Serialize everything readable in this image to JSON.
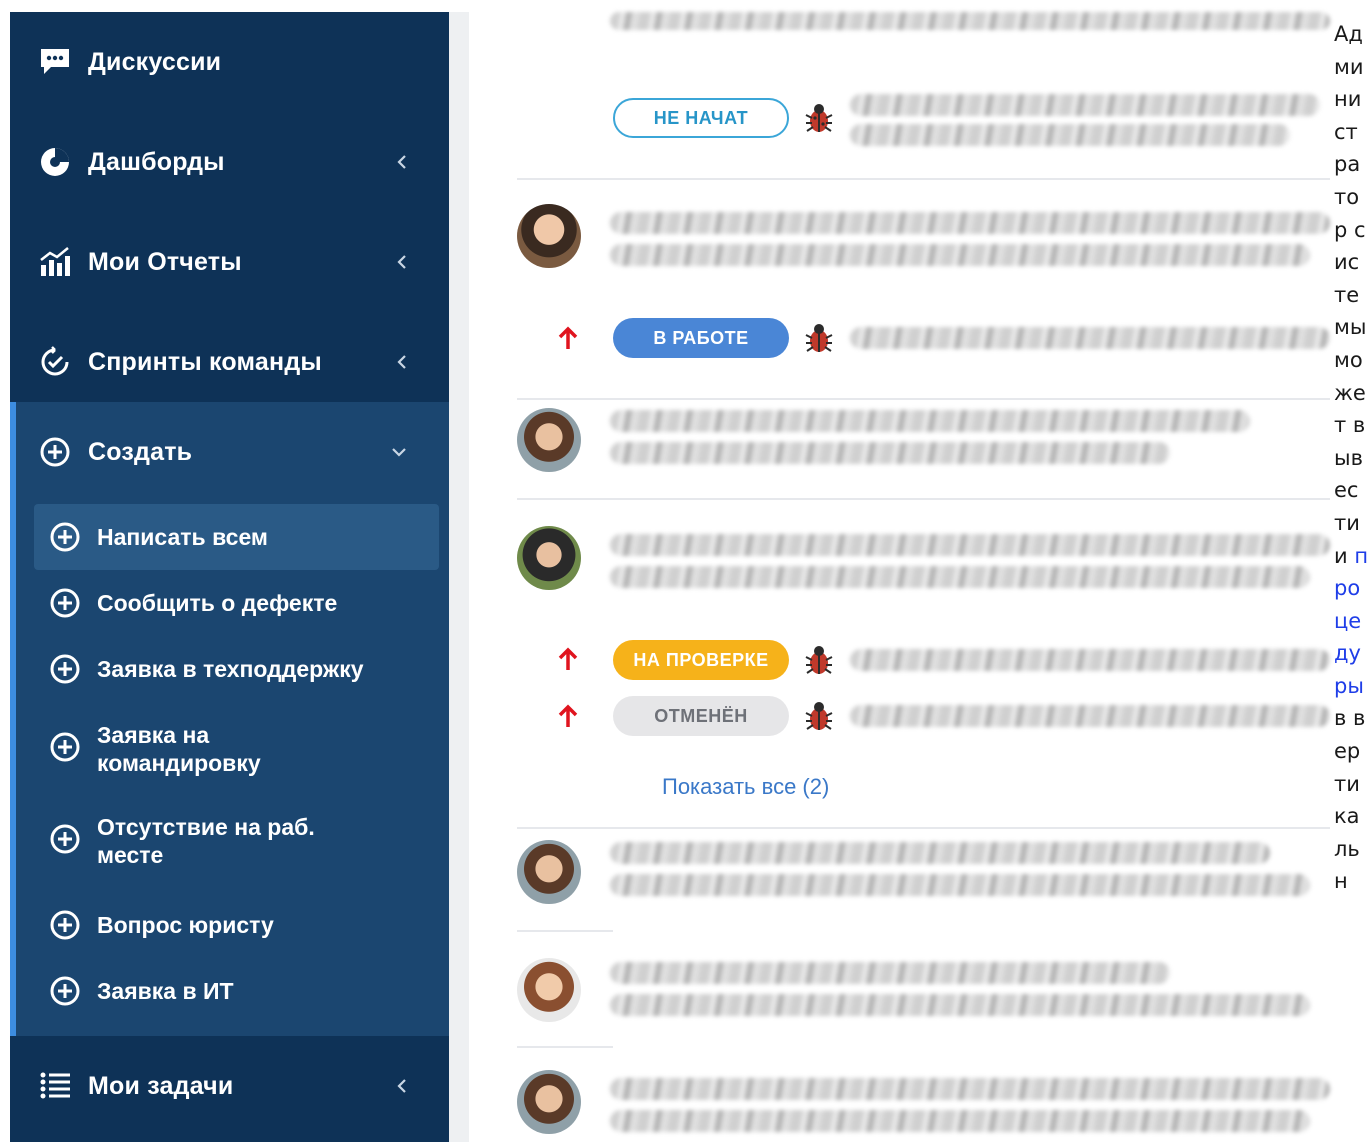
{
  "sidebar": {
    "items": [
      {
        "label": "Дискуссии",
        "icon": "chat-icon"
      },
      {
        "label": "Дашборды",
        "icon": "pie-chart-icon"
      },
      {
        "label": "Мои Отчеты",
        "icon": "reports-chart-icon"
      },
      {
        "label": "Спринты команды",
        "icon": "sprint-icon"
      },
      {
        "label": "Создать",
        "icon": "plus-circle-icon"
      },
      {
        "label": "Мои задачи",
        "icon": "list-icon"
      }
    ],
    "create_items": [
      {
        "label": "Написать всем"
      },
      {
        "label": "Сообщить о дефекте"
      },
      {
        "label": "Заявка в техподдержку"
      },
      {
        "label": "Заявка на командировку"
      },
      {
        "label": "Отсутствие на раб. месте"
      },
      {
        "label": "Вопрос юристу"
      },
      {
        "label": "Заявка в ИТ"
      }
    ]
  },
  "feed": {
    "badges": {
      "not_started": "НЕ НАЧАТ",
      "in_work": "В РАБОТЕ",
      "review": "НА ПРОВЕРКЕ",
      "cancelled": "ОТМЕНЁН"
    },
    "show_all": "Показать все (2)"
  },
  "right_text": {
    "before": "Администратор системы может вывести и",
    "link": "процедуры",
    "after": "в вертикальн"
  },
  "colors": {
    "sidebar_bg": "#0e3257",
    "create_bg": "#1b4670",
    "accent": "#3d8de0",
    "not_started": "#3ba6d8",
    "in_work": "#4a86d6",
    "review": "#f6b21a",
    "cancelled": "#e6e6e8",
    "priority_arrow": "#e0141e",
    "link": "#1f3ee8"
  }
}
